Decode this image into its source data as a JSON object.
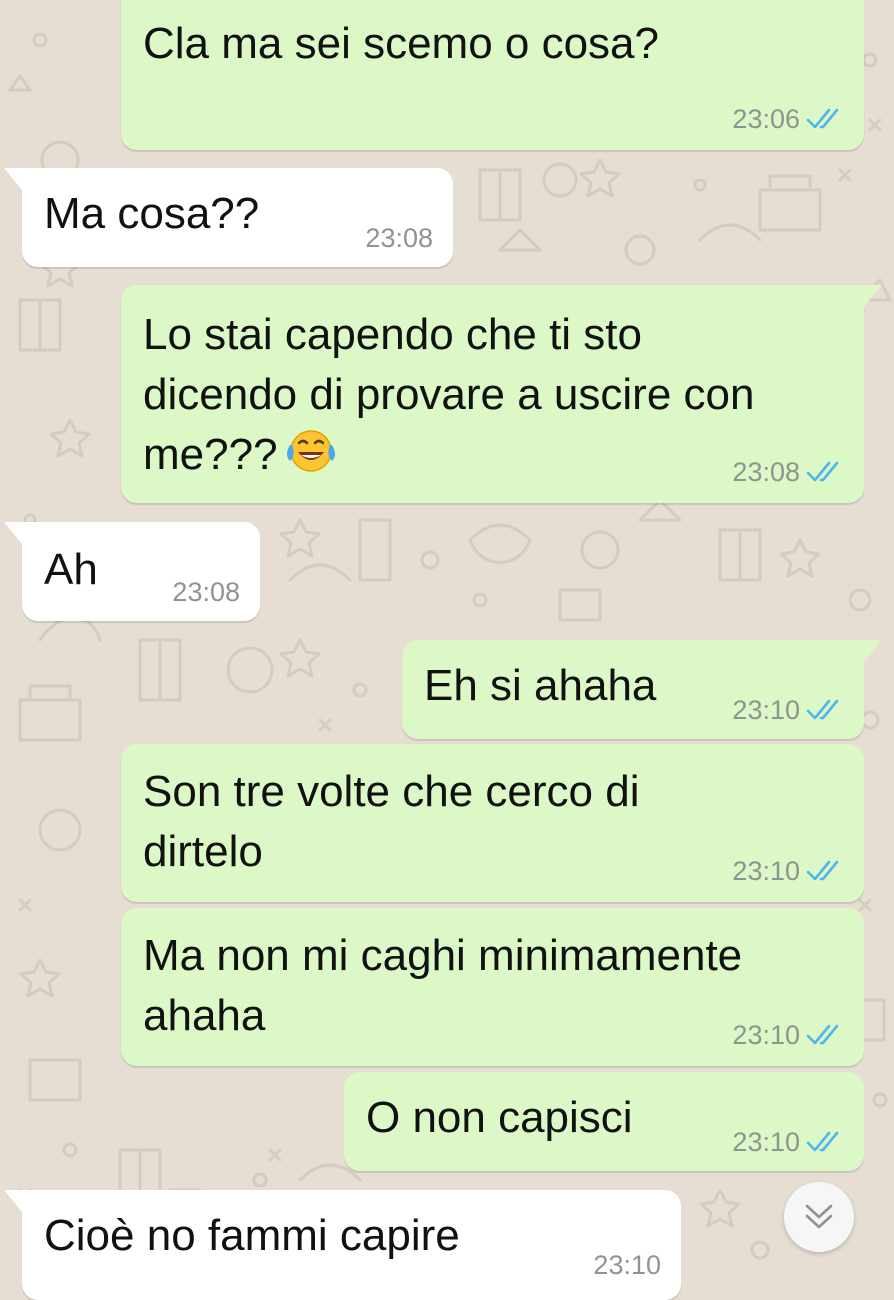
{
  "chat": {
    "messages": [
      {
        "direction": "outgoing",
        "text": "Cla ma sei scemo o cosa?",
        "time": "23:06",
        "status": "read"
      },
      {
        "direction": "incoming",
        "text": "Ma cosa??",
        "time": "23:08"
      },
      {
        "direction": "outgoing",
        "lines": [
          "Lo stai capendo che ti sto",
          "dicendo di provare a uscire con",
          "me???"
        ],
        "emoji": "face-with-tears-of-joy",
        "time": "23:08",
        "status": "read"
      },
      {
        "direction": "incoming",
        "text": "Ah",
        "time": "23:08"
      },
      {
        "direction": "outgoing",
        "text": "Eh si ahaha",
        "time": "23:10",
        "status": "read"
      },
      {
        "direction": "outgoing",
        "lines": [
          "Son tre volte che cerco di",
          "dirtelo"
        ],
        "time": "23:10",
        "status": "read"
      },
      {
        "direction": "outgoing",
        "lines": [
          "Ma non mi caghi minimamente",
          "ahaha"
        ],
        "time": "23:10",
        "status": "read"
      },
      {
        "direction": "outgoing",
        "text": "O non capisci",
        "time": "23:10",
        "status": "read"
      },
      {
        "direction": "incoming",
        "text": "Cioè no fammi capire",
        "time": "23:10"
      }
    ],
    "scroll_button_icon": "double-chevron-down-icon",
    "read_tick_icon": "double-check-icon"
  },
  "colors": {
    "wallpaper": "#e6ded3",
    "outgoing_bubble": "#dcf8c6",
    "incoming_bubble": "#ffffff",
    "read_ticks": "#4fb6ec",
    "timestamp": "#8d9590"
  }
}
